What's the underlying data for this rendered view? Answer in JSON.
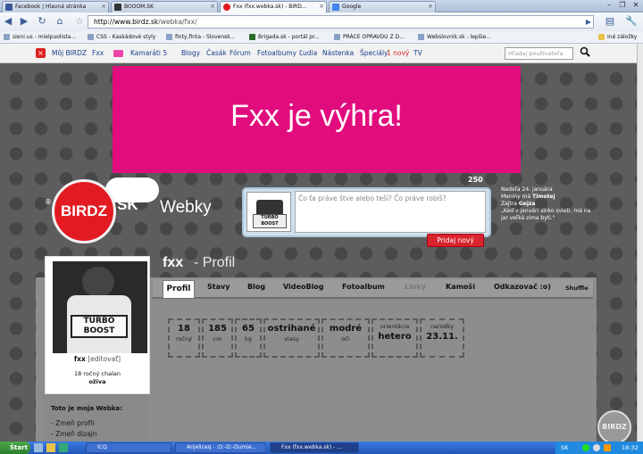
{
  "browser": {
    "tabs": [
      {
        "title": "Facebook | Hlavná stránka",
        "color": "#3b5998"
      },
      {
        "title": "BOOOM.SK",
        "color": "#333333"
      },
      {
        "title": "Fxx (fxx.webka.sk) - BIRD...",
        "color": "#e21b23",
        "active": true
      },
      {
        "title": "Google",
        "color": "#4285f4"
      }
    ],
    "url_prefix": "http://www.birdz.sk",
    "url_path": "/webka/fxx/",
    "bookmarks": [
      "sieni.us - mielpuolista...",
      "CSS - Kaskádové styly",
      "finty,finta - Slovensk...",
      "Brigada.sk - portál pr...",
      "PRÁCE OPRAVDU Z D...",
      "Webslovnik.sk - lepšie..."
    ],
    "other_bookmarks": "Iné záložky"
  },
  "site_nav": {
    "items": [
      "Môj BIRDZ",
      "Fxx",
      "Kamaráti 5",
      "Blogy",
      "Časák",
      "Fórum",
      "Fotoalbumy",
      "Ľudia",
      "Nástenka",
      "Špeciály",
      "TV"
    ],
    "special_badge": "1 nový",
    "search_placeholder": "Hľadaj používateľa"
  },
  "banner_text": "Fxx je výhra!",
  "logo": {
    "birdz": "BIRDZ",
    "sk": "SK",
    "webky": "Webky",
    "reg": "®"
  },
  "status": {
    "count": "250",
    "placeholder": "Čo ťa práve štve alebo teší? Čo práve robíš?",
    "button": "Pridaj nový",
    "avatar_text": "TURBO BOOST"
  },
  "sidenote": {
    "l1": "Nedeľa 24. januára",
    "l2a": "Meniny má ",
    "l2b": "Timotej",
    "l3a": "Zajtra ",
    "l3b": "Gejza",
    "l4": "„Keď v januári slnko svieti, má na jar veľká zima byti.\""
  },
  "profile": {
    "name": "fxx",
    "edit": "[editovať]",
    "desc1": "18 ročný chalan",
    "desc2": "oživa",
    "photo_text": "TURBO BOOST",
    "heading_name": "fxx",
    "heading_sep": "- Profil"
  },
  "profile_tabs": [
    "Profil",
    "Stavy",
    "Blog",
    "VideoBlog",
    "Fotoalbum",
    "Linky",
    "Kamoši",
    "Odkazovač :o)",
    "Shuffle"
  ],
  "stats": [
    {
      "value": "18",
      "label": "ročný"
    },
    {
      "value": "185",
      "label": "cm"
    },
    {
      "value": "65",
      "label": "kg"
    },
    {
      "value": "ostrihané",
      "label": "vlasy"
    },
    {
      "value": "modré",
      "label": "oči"
    },
    {
      "value": "hetero",
      "label": "orientácia"
    },
    {
      "value": "23.11.",
      "label": "narodky"
    }
  ],
  "webka_box": {
    "title": "Toto je moja Webka:",
    "links": [
      "- Zmeň profil",
      "- Zmeň dizajn"
    ]
  },
  "badge": "BIRDZ",
  "taskbar": {
    "start": "Štart",
    "items": [
      "ICQ",
      "Anjeliceq - :O:-D:-Dumie...",
      "Fxx (fxx.webka.sk) - ..."
    ],
    "lang": "SK",
    "time": "18:32"
  }
}
